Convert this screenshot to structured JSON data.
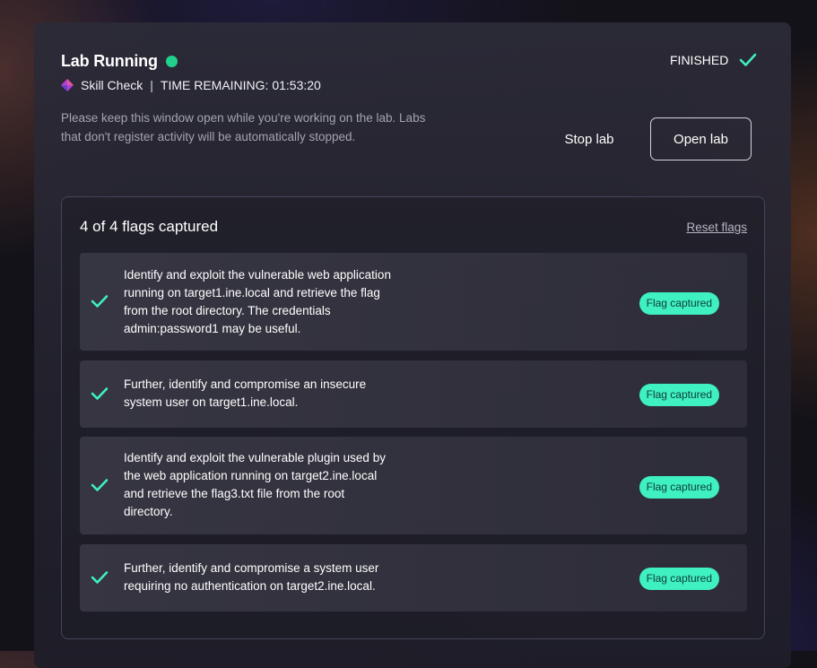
{
  "header": {
    "title": "Lab Running",
    "status_indicator": "online-dot",
    "category": "Skill Check",
    "separator": "|",
    "time_remaining": "TIME REMAINING: 01:53:20",
    "notice": "Please keep this window open while you're working on the lab. Labs that don't register activity will be automatically stopped.",
    "finished_label": "FINISHED"
  },
  "actions": {
    "stop_label": "Stop lab",
    "open_label": "Open lab"
  },
  "flags": {
    "summary": "4 of 4 flags captured",
    "reset_label": "Reset flags",
    "items": [
      {
        "text": "Identify and exploit the vulnerable web application running on target1.ine.local and retrieve the flag from the root directory. The credentials admin:password1 may be useful.",
        "status": "Flag captured"
      },
      {
        "text": "Further, identify and compromise an insecure system user on target1.ine.local.",
        "status": "Flag captured"
      },
      {
        "text": "Identify and exploit the vulnerable plugin used by the web application running on target2.ine.local and retrieve the flag3.txt file from the root directory.",
        "status": "Flag captured"
      },
      {
        "text": "Further, identify and compromise a system user requiring no authentication on target2.ine.local.",
        "status": "Flag captured"
      }
    ]
  },
  "colors": {
    "accent_green": "#21d18d",
    "check_teal": "#3ff0c0",
    "badge_bg": "#3ff0c0",
    "badge_text": "#0e3d33",
    "brand_purple": "#b23fd6"
  },
  "icons": {
    "status": "green-dot-icon",
    "category": "diamond-icon",
    "finished": "checkmark-icon",
    "flag": "checkmark-icon"
  }
}
